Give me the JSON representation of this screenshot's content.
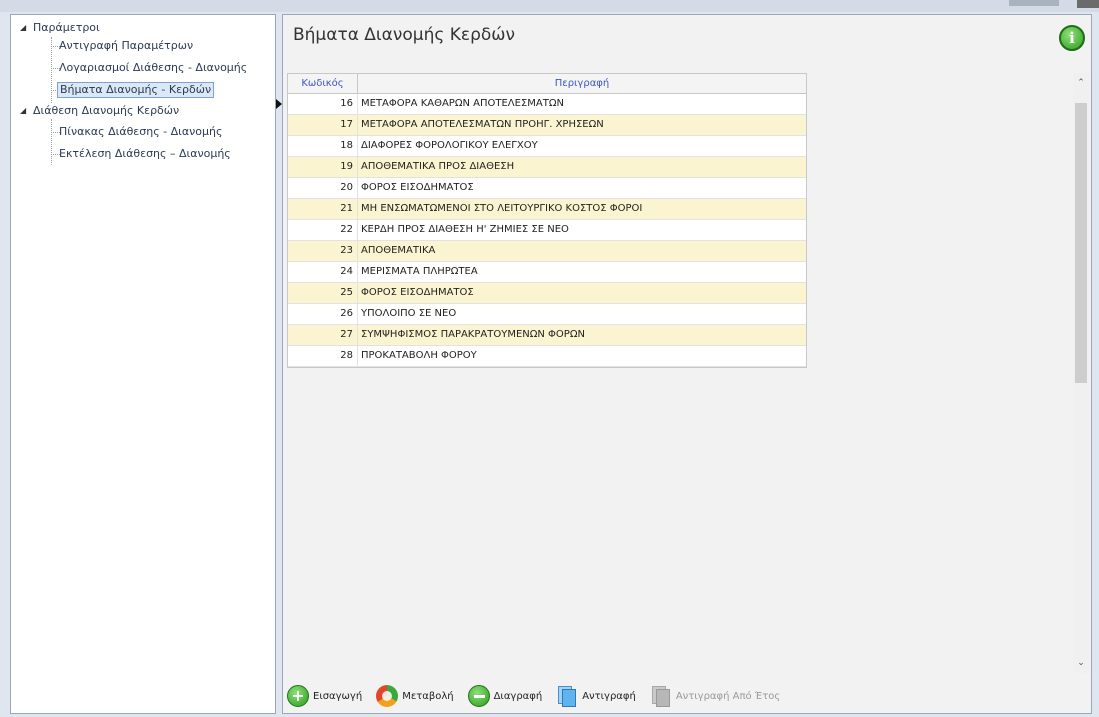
{
  "tree": {
    "nodes": [
      {
        "label": "Παράμετροι",
        "level": 0,
        "expanded": true
      },
      {
        "label": "Αντιγραφή Παραμέτρων",
        "level": 1
      },
      {
        "label": "Λογαριασμοί Διάθεσης - Διανομής",
        "level": 1
      },
      {
        "label": "Βήματα Διανομής - Κερδών",
        "level": 1,
        "selected": true
      },
      {
        "label": "Διάθεση Διανομής Κερδών",
        "level": 0,
        "expanded": true
      },
      {
        "label": "Πίνακας Διάθεσης - Διανομής",
        "level": 1
      },
      {
        "label": "Εκτέλεση Διάθεσης – Διανομής",
        "level": 1
      }
    ]
  },
  "main": {
    "title": "Βήματα Διανομής Κερδών",
    "info_icon": "info-icon"
  },
  "grid": {
    "columns": [
      "Κωδικός",
      "Περιγραφή"
    ],
    "rows": [
      {
        "code": "16",
        "desc": "ΜΕΤΑΦΟΡΑ ΚΑΘΑΡΩΝ ΑΠΟΤΕΛΕΣΜΑΤΩΝ"
      },
      {
        "code": "17",
        "desc": "ΜΕΤΑΦΟΡΑ ΑΠΟΤΕΛΕΣΜΑΤΩΝ ΠΡΟΗΓ. ΧΡΗΣΕΩΝ"
      },
      {
        "code": "18",
        "desc": "ΔΙΑΦΟΡΕΣ ΦΟΡΟΛΟΓΙΚΟΥ ΕΛΕΓΧΟΥ"
      },
      {
        "code": "19",
        "desc": "ΑΠΟΘΕΜΑΤΙΚΑ ΠΡΟΣ ΔΙΑΘΕΣΗ"
      },
      {
        "code": "20",
        "desc": "ΦΟΡΟΣ ΕΙΣΟΔΗΜΑΤΟΣ"
      },
      {
        "code": "21",
        "desc": "ΜΗ ΕΝΣΩΜΑΤΩΜΕΝΟΙ ΣΤΟ ΛΕΙΤΟΥΡΓΙΚΟ ΚΟΣΤΟΣ ΦΟΡΟΙ"
      },
      {
        "code": "22",
        "desc": "ΚΕΡΔΗ ΠΡΟΣ ΔΙΑΘΕΣΗ Η' ΖΗΜΙΕΣ ΣΕ ΝΕΟ"
      },
      {
        "code": "23",
        "desc": "ΑΠΟΘΕΜΑΤΙΚΑ"
      },
      {
        "code": "24",
        "desc": "ΜΕΡΙΣΜΑΤΑ ΠΛΗΡΩΤΕΑ"
      },
      {
        "code": "25",
        "desc": "ΦΟΡΟΣ ΕΙΣΟΔΗΜΑΤΟΣ"
      },
      {
        "code": "26",
        "desc": "ΥΠΟΛΟΙΠΟ ΣΕ ΝΕΟ"
      },
      {
        "code": "27",
        "desc": "ΣΥΜΨΗΦΙΣΜΟΣ ΠΑΡΑΚΡΑΤΟΥΜΕΝΩΝ ΦΟΡΩΝ"
      },
      {
        "code": "28",
        "desc": "ΠΡΟΚΑΤΑΒΟΛΗ ΦΟΡΟΥ"
      }
    ]
  },
  "toolbar": {
    "insert_label": "Εισαγωγή",
    "edit_label": "Μεταβολή",
    "delete_label": "Διαγραφή",
    "copy_label": "Αντιγραφή",
    "copy_year_label": "Αντιγραφή Από Έτος"
  },
  "colors": {
    "row_alt": "#fbf4d0",
    "header_text": "#3b57c7",
    "selected_node": "#dbe8f7"
  }
}
